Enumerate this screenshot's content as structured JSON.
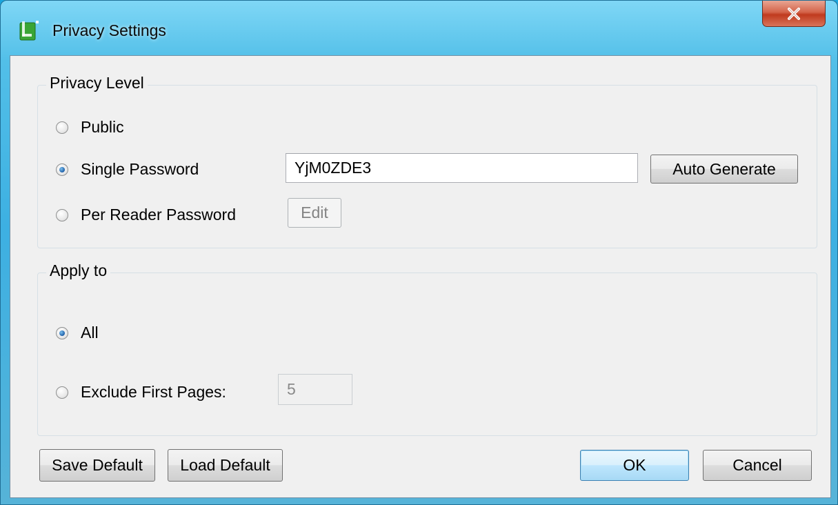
{
  "window": {
    "title": "Privacy Settings",
    "close_symbol": "x"
  },
  "privacy_level": {
    "legend": "Privacy Level",
    "options": [
      {
        "label": "Public",
        "checked": false
      },
      {
        "label": "Single Password",
        "checked": true
      },
      {
        "label": "Per Reader Password",
        "checked": false
      }
    ],
    "password_value": "YjM0ZDE3",
    "auto_generate_label": "Auto Generate",
    "edit_label": "Edit"
  },
  "apply_to": {
    "legend": "Apply to",
    "options": [
      {
        "label": "All",
        "checked": true
      },
      {
        "label": "Exclude First Pages:",
        "checked": false
      }
    ],
    "exclude_pages_value": "5"
  },
  "footer": {
    "save_default_label": "Save Default",
    "load_default_label": "Load Default",
    "ok_label": "OK",
    "cancel_label": "Cancel"
  },
  "colors": {
    "title_bar": "#52bfe8",
    "close_button": "#c8452a",
    "dialog_background": "#f0f0f0",
    "radio_checked": "#1f5fa8",
    "default_button_border": "#3c7fb1"
  },
  "icons": {
    "app": "app-icon",
    "close": "close-icon"
  }
}
